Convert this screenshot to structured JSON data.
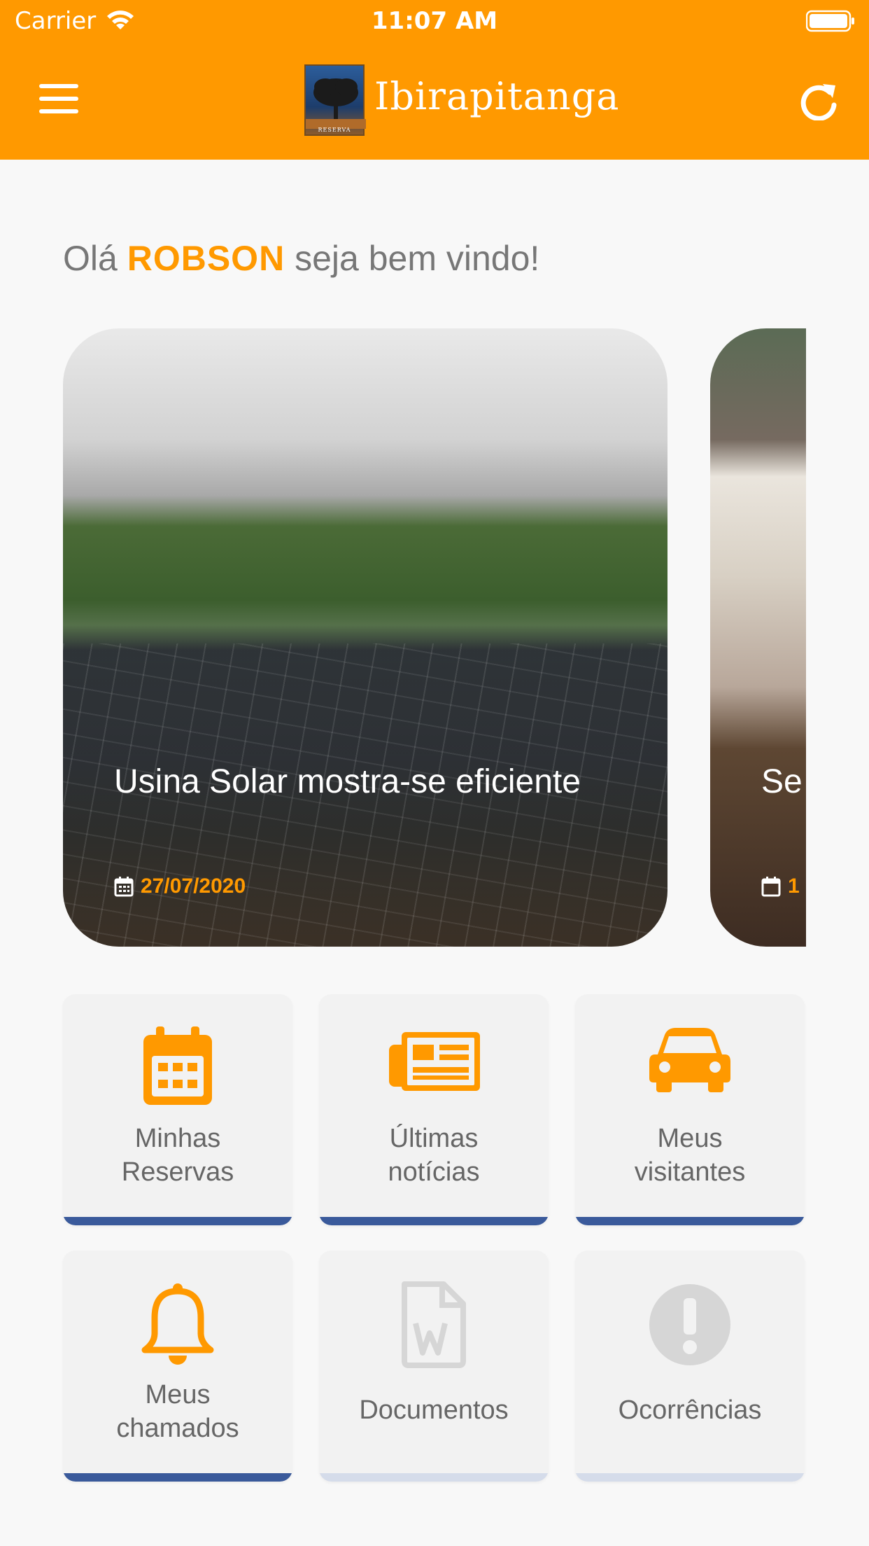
{
  "status_bar": {
    "carrier": "Carrier",
    "time": "11:07 AM"
  },
  "header": {
    "logo_text": "Ibirapitanga",
    "logo_subtext": "RESERVA"
  },
  "greeting": {
    "prefix": "Olá",
    "name": "ROBSON",
    "suffix": "seja bem vindo!"
  },
  "news": [
    {
      "title": "Usina Solar mostra-se eficiente",
      "date": "27/07/2020"
    },
    {
      "title": "Se ate",
      "date": "1"
    }
  ],
  "tiles": [
    {
      "label_line1": "Minhas",
      "label_line2": "Reservas",
      "icon": "calendar-icon",
      "enabled": true
    },
    {
      "label_line1": "Últimas",
      "label_line2": "notícias",
      "icon": "newspaper-icon",
      "enabled": true
    },
    {
      "label_line1": "Meus",
      "label_line2": "visitantes",
      "icon": "car-icon",
      "enabled": true
    },
    {
      "label_line1": "Meus",
      "label_line2": "chamados",
      "icon": "bell-icon",
      "enabled": true
    },
    {
      "label": "Documentos",
      "icon": "word-document-icon",
      "enabled": false
    },
    {
      "label": "Ocorrências",
      "icon": "exclamation-circle-icon",
      "enabled": false
    }
  ],
  "colors": {
    "accent": "#ff9900",
    "tile_bar": "#3a5a9b",
    "tile_bar_disabled": "#d5dcea",
    "disabled_icon": "#d6d6d6"
  }
}
